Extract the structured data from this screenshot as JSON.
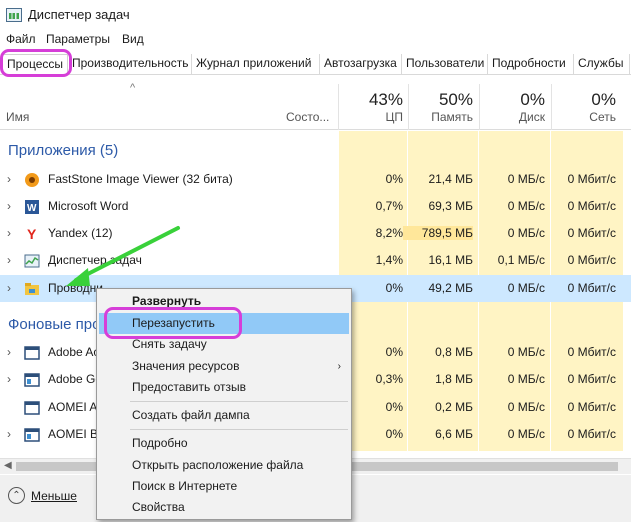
{
  "window": {
    "title": "Диспетчер задач",
    "icon": "task-manager-icon"
  },
  "menubar": [
    "Файл",
    "Параметры",
    "Вид"
  ],
  "tabs": [
    {
      "label": "Процессы",
      "active": true
    },
    {
      "label": "Производительность"
    },
    {
      "label": "Журнал приложений"
    },
    {
      "label": "Автозагрузка"
    },
    {
      "label": "Пользователи"
    },
    {
      "label": "Подробности"
    },
    {
      "label": "Службы"
    }
  ],
  "columns": {
    "name": "Имя",
    "status": "Состо...",
    "cpu": {
      "pct": "43%",
      "label": "ЦП"
    },
    "memory": {
      "pct": "50%",
      "label": "Память"
    },
    "disk": {
      "pct": "0%",
      "label": "Диск"
    },
    "network": {
      "pct": "0%",
      "label": "Сеть"
    }
  },
  "groups": {
    "apps": "Приложения (5)",
    "background": "Фоновые про"
  },
  "apps": [
    {
      "name": "FastStone Image Viewer (32 бита)",
      "icon": "faststone-icon",
      "cpu": "0%",
      "mem": "21,4 МБ",
      "disk": "0 МБ/с",
      "net": "0 Мбит/с"
    },
    {
      "name": "Microsoft Word",
      "icon": "word-icon",
      "cpu": "0,7%",
      "mem": "69,3 МБ",
      "disk": "0 МБ/с",
      "net": "0 Мбит/с"
    },
    {
      "name": "Yandex (12)",
      "icon": "yandex-icon",
      "cpu": "8,2%",
      "mem": "789,5 МБ",
      "disk": "0 МБ/с",
      "net": "0 Мбит/с"
    },
    {
      "name": "Диспетчер задач",
      "icon": "task-manager-icon",
      "cpu": "1,4%",
      "mem": "16,1 МБ",
      "disk": "0,1 МБ/с",
      "net": "0 Мбит/с"
    },
    {
      "name": "Проводни",
      "icon": "explorer-icon",
      "cpu": "0%",
      "mem": "49,2 МБ",
      "disk": "0 МБ/с",
      "net": "0 Мбит/с"
    }
  ],
  "background": [
    {
      "name": "Adobe Ac",
      "icon": "app-window-icon",
      "cpu": "0%",
      "mem": "0,8 МБ",
      "disk": "0 МБ/с",
      "net": "0 Мбит/с"
    },
    {
      "name": "Adobe Ge",
      "icon": "app-window-icon",
      "cpu": "0,3%",
      "mem": "1,8 МБ",
      "disk": "0 МБ/с",
      "net": "0 Мбит/с"
    },
    {
      "name": "AOMEI AE",
      "icon": "app-window-icon",
      "cpu": "0%",
      "mem": "0,2 МБ",
      "disk": "0 МБ/с",
      "net": "0 Мбит/с"
    },
    {
      "name": "AOMEI Ba",
      "icon": "app-window-icon",
      "cpu": "0%",
      "mem": "6,6 МБ",
      "disk": "0 МБ/с",
      "net": "0 Мбит/с"
    }
  ],
  "context_menu": {
    "expand": "Развернуть",
    "restart": "Перезапустить",
    "end_task": "Снять задачу",
    "resource_values": "Значения ресурсов",
    "feedback": "Предоставить отзыв",
    "dump": "Создать файл дампа",
    "details": "Подробно",
    "open_location": "Открыть расположение файла",
    "search_online": "Поиск в Интернете",
    "properties": "Свойства"
  },
  "footer": {
    "less": "Меньше"
  },
  "colors": {
    "highlight": "#d63ed8",
    "arrow": "#39d13a",
    "yellow": "#fff4c4",
    "selected": "#cde8ff"
  }
}
